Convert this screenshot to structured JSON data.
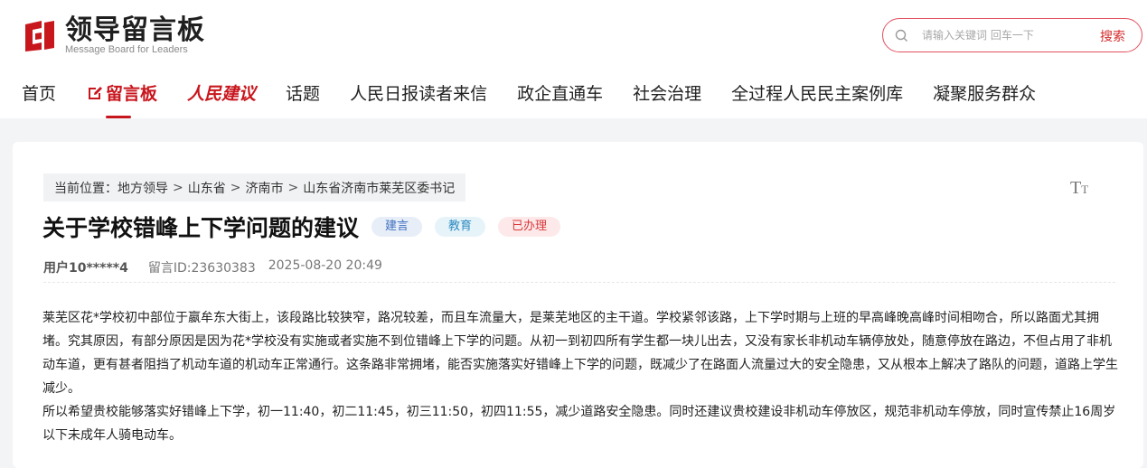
{
  "header": {
    "logo_title": "领导留言板",
    "logo_sub": "Message Board for Leaders",
    "search_placeholder": "请输入关键词 回车一下",
    "search_button": "搜索"
  },
  "nav": {
    "items": [
      {
        "label": "首页"
      },
      {
        "label": "留言板"
      },
      {
        "label": "人民建议"
      },
      {
        "label": "话题"
      },
      {
        "label": "人民日报读者来信"
      },
      {
        "label": "政企直通车"
      },
      {
        "label": "社会治理"
      },
      {
        "label": "全过程人民民主案例库"
      },
      {
        "label": "凝聚服务群众"
      }
    ]
  },
  "breadcrumb": {
    "prefix": "当前位置：",
    "items": [
      "地方领导",
      "山东省",
      "济南市",
      "山东省济南市莱芜区委书记"
    ],
    "separator": ">"
  },
  "font_size_icon": {
    "big": "T",
    "small": "T"
  },
  "post": {
    "title": "关于学校错峰上下学问题的建议",
    "tags": [
      {
        "label": "建言"
      },
      {
        "label": "教育"
      },
      {
        "label": "已办理"
      }
    ],
    "user": "用户10*****4",
    "message_id": "留言ID:23630383",
    "datetime": "2025-08-20 20:49",
    "paragraphs": [
      "莱芜区花*学校初中部位于嬴牟东大街上，该段路比较狭窄，路况较差，而且车流量大，是莱芜地区的主干道。学校紧邻该路，上下学时期与上班的早高峰晚高峰时间相吻合，所以路面尤其拥堵。究其原因，有部分原因是因为花*学校没有实施或者实施不到位错峰上下学的问题。从初一到初四所有学生都一块儿出去，又没有家长非机动车辆停放处，随意停放在路边，不但占用了非机动车道，更有甚者阻挡了机动车道的机动车正常通行。这条路非常拥堵，能否实施落实好错峰上下学的问题，既减少了在路面人流量过大的安全隐患，又从根本上解决了路队的问题，道路上学生减少。",
      "所以希望贵校能够落实好错峰上下学，初一11:40，初二11:45，初三11:50，初四11:55，减少道路安全隐患。同时还建议贵校建设非机动车停放区，规范非机动车停放，同时宣传禁止16周岁以下未成年人骑电动车。"
    ]
  },
  "colors": {
    "brand_red": "#c8161d",
    "search_border": "#e0525f"
  }
}
